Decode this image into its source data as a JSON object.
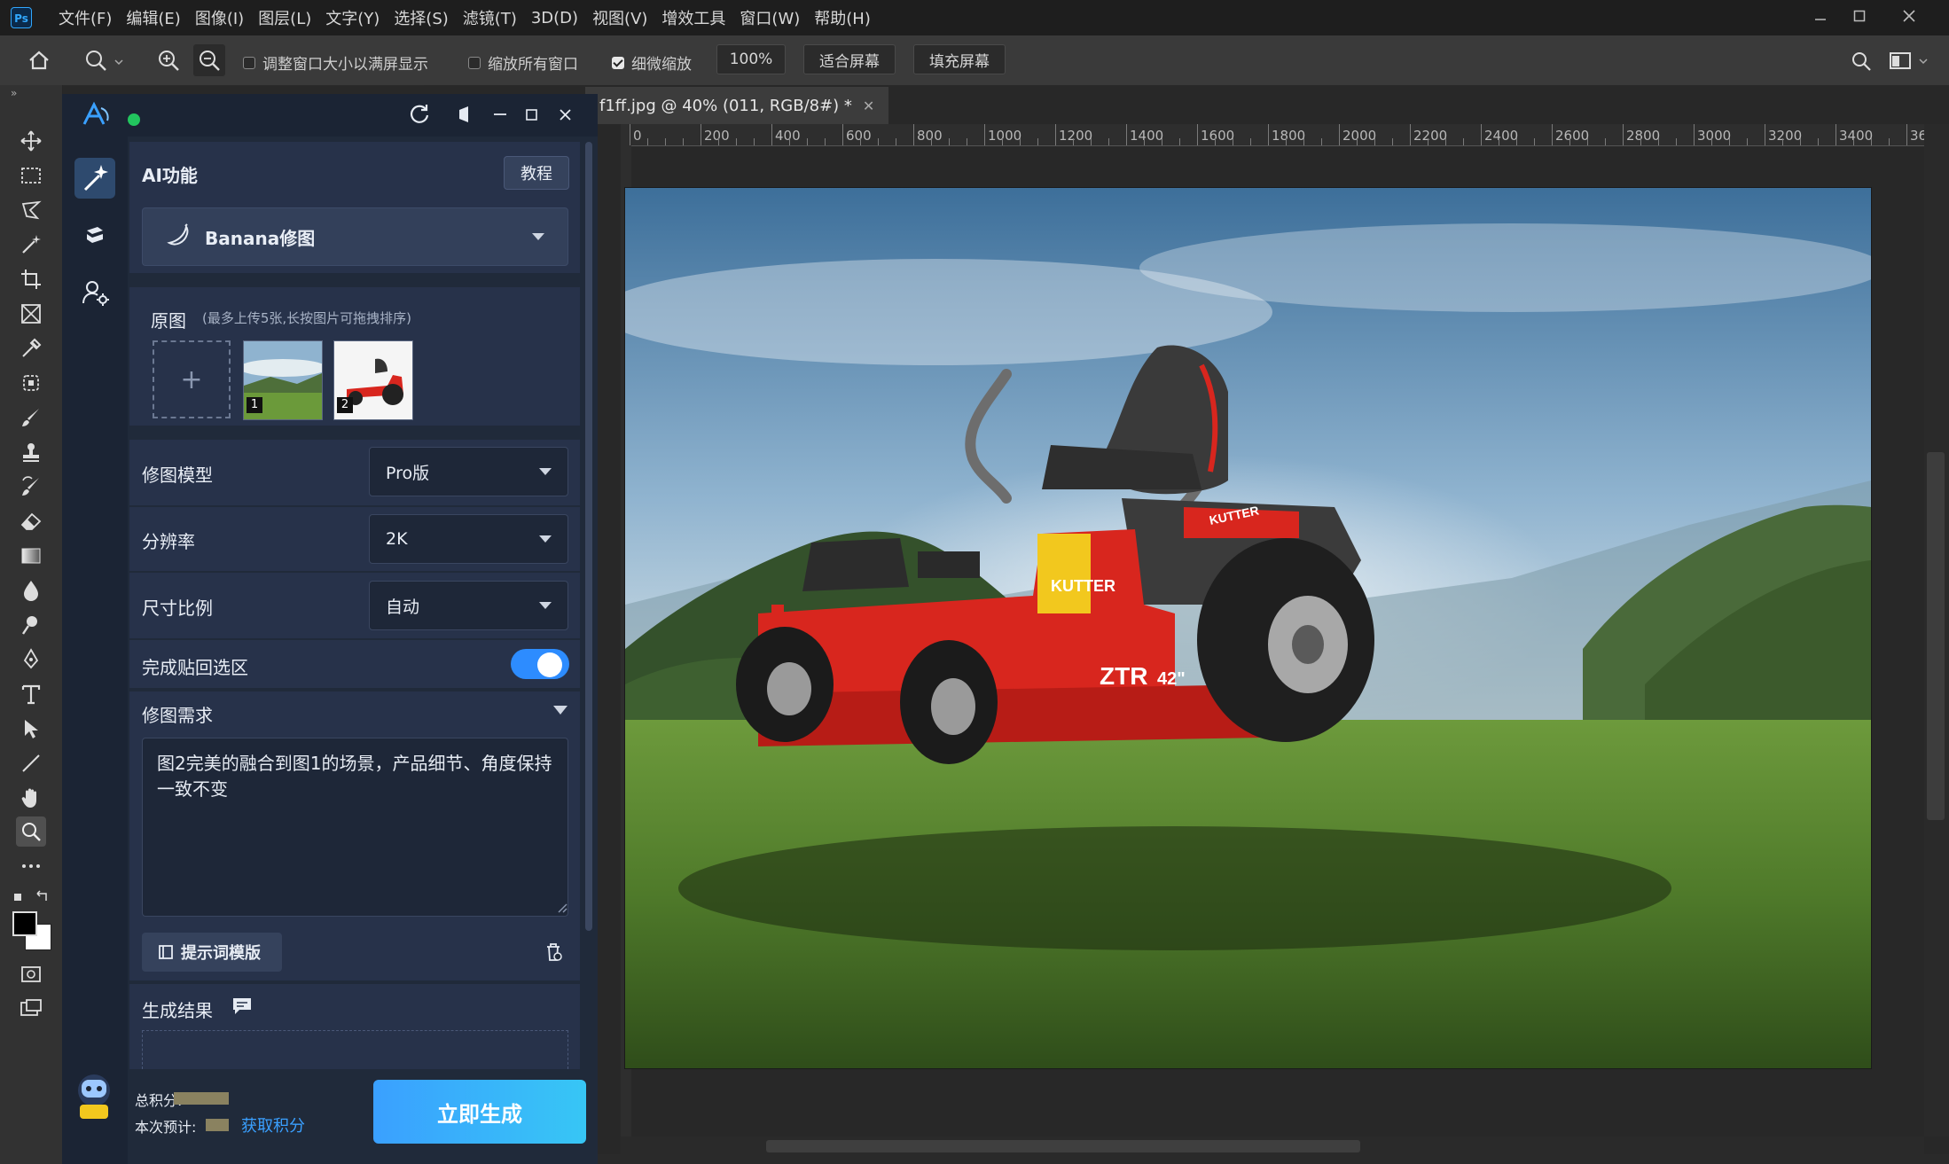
{
  "app": {
    "logo_text": "Ps"
  },
  "menu": [
    "文件(F)",
    "编辑(E)",
    "图像(I)",
    "图层(L)",
    "文字(Y)",
    "选择(S)",
    "滤镜(T)",
    "3D(D)",
    "视图(V)",
    "增效工具",
    "窗口(W)",
    "帮助(H)"
  ],
  "options": {
    "resize_windows_label": "调整窗口大小以满屏显示",
    "zoom_all_label": "缩放所有窗口",
    "scrubby_zoom_label": "细微缩放",
    "zoom_value": "100%",
    "fit_screen": "适合屏幕",
    "fill_screen": "填充屏幕"
  },
  "document": {
    "tab_title": "f1ff.jpg @ 40% (011, RGB/8#) *",
    "ruler_labels": [
      "0",
      "200",
      "400",
      "600",
      "800",
      "1000",
      "1200",
      "1400",
      "1600",
      "1800",
      "2000",
      "2200",
      "2400",
      "2600",
      "2800",
      "3000",
      "3200",
      "3400",
      "36"
    ]
  },
  "plugin": {
    "section_title": "AI功能",
    "tutorial_button": "教程",
    "feature_select": "Banana修图",
    "source": {
      "label": "原图",
      "hint": "(最多上传5张,长按图片可拖拽排序)",
      "thumb_badges": [
        "1",
        "2"
      ]
    },
    "model": {
      "label": "修图模型",
      "value": "Pro版"
    },
    "resolution": {
      "label": "分辨率",
      "value": "2K"
    },
    "ratio": {
      "label": "尺寸比例",
      "value": "自动"
    },
    "paste_back": {
      "label": "完成贴回选区",
      "on": true
    },
    "requirement": {
      "label": "修图需求",
      "text": "图2完美的融合到图1的场景，产品细节、角度保持一致不变"
    },
    "template_button": "提示词模版",
    "result_label": "生成结果",
    "points_total_label": "总积分:",
    "points_estimate_label": "本次预计:",
    "get_points_link": "获取积分",
    "generate_button": "立即生成"
  },
  "canvas_image": {
    "brand_text": "KUTTER",
    "model_text": "ZTR",
    "deck_size": "42\""
  },
  "colors": {
    "accent_blue": "#2d8cff",
    "mower_red": "#d8261e",
    "panel_bg": "#202a3a"
  }
}
